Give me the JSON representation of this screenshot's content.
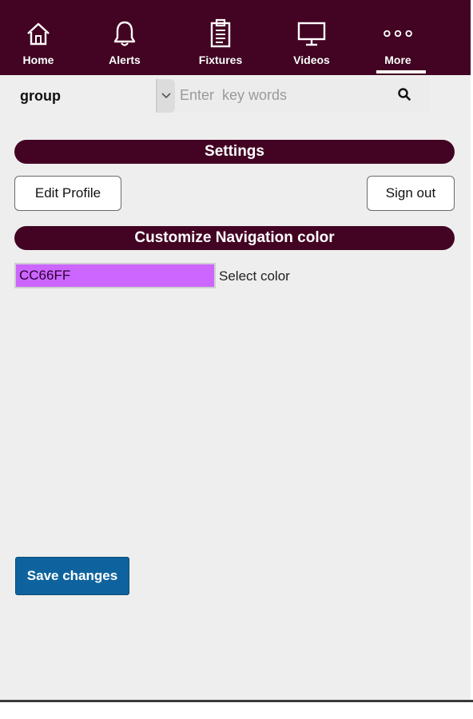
{
  "colors": {
    "nav_background": "#430423",
    "nav_text": "#ffffff",
    "page_background": "#eeeeee",
    "section_header_background": "#430423",
    "selected_color_swatch": "#CC66FF",
    "save_button_background": "#0e639e"
  },
  "nav": {
    "items": [
      {
        "label": "Home",
        "icon": "home-icon"
      },
      {
        "label": "Alerts",
        "icon": "bell-icon"
      },
      {
        "label": "Fixtures",
        "icon": "clipboard-icon"
      },
      {
        "label": "Videos",
        "icon": "monitor-icon"
      },
      {
        "label": "More",
        "icon": "more-dots-icon"
      }
    ],
    "active": "More"
  },
  "search": {
    "group_label": "group",
    "placeholder": "Enter  key words",
    "value": ""
  },
  "settings": {
    "title": "Settings",
    "edit_profile_label": "Edit Profile",
    "sign_out_label": "Sign out"
  },
  "navigation_color": {
    "title": "Customize Navigation color",
    "value": "CC66FF",
    "select_label": "Select color"
  },
  "save_label": "Save changes"
}
